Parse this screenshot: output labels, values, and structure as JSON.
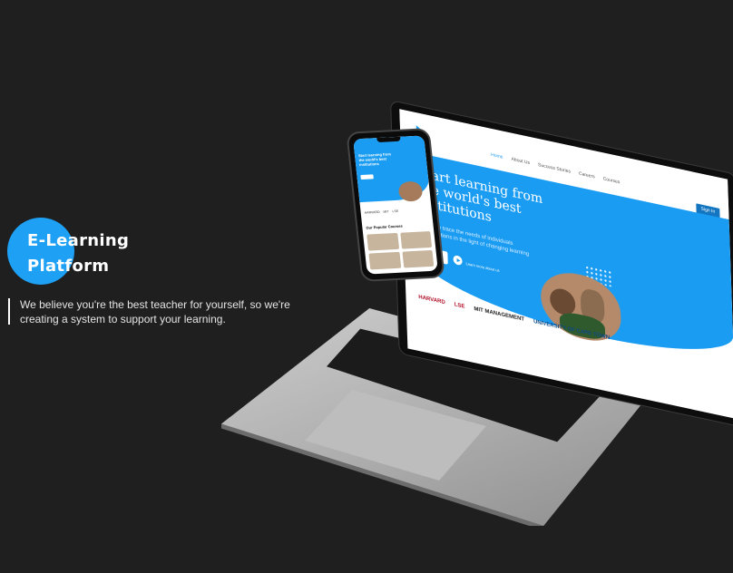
{
  "hero": {
    "title_line1": "E-Learning",
    "title_line2": "Platform",
    "description": "We believe you're the best teacher for yourself, so we're creating a system to support your learning."
  },
  "laptop_site": {
    "nav_links": [
      "Home",
      "About Us",
      "Success Stories",
      "Careers",
      "Courses"
    ],
    "sign_in": "Sign In",
    "headline": "Start learning from the world's best institutions",
    "subtext": "Carefully trace the needs of individuals organizations in the light of changing learning",
    "watch_link": "Learn more about us",
    "logos": [
      "HARVARD",
      "LSE",
      "MIT MANAGEMENT",
      "UNIVERSITY OF CAPE TOWN"
    ]
  },
  "phone_site": {
    "headline": "Start learning from the world's best institutions",
    "section_title": "Our Popular Courses",
    "logos": [
      "HARVARD",
      "MIT",
      "LSE"
    ]
  },
  "colors": {
    "background": "#1f1f1f",
    "accent": "#1ea0f4",
    "site_primary": "#1a9cf3"
  }
}
